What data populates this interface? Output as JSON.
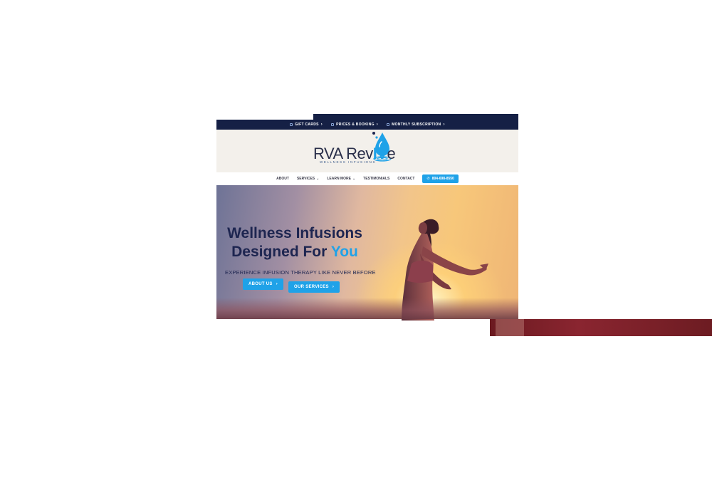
{
  "topbar": {
    "items": [
      {
        "label": "GIFT CARDS"
      },
      {
        "label": "PRICES & BOOKING"
      },
      {
        "label": "MONTHLY SUBSCRIPTION"
      }
    ]
  },
  "logo": {
    "brand_start": "RVA Rev",
    "brand_iv": "IV",
    "brand_end": "e",
    "tagline": "WELLNESS INFUSIONS"
  },
  "nav": {
    "items": [
      {
        "label": "ABOUT",
        "has_dropdown": false
      },
      {
        "label": "SERVICES",
        "has_dropdown": true
      },
      {
        "label": "LEARN MORE",
        "has_dropdown": true
      },
      {
        "label": "TESTIMONIALS",
        "has_dropdown": false
      },
      {
        "label": "CONTACT",
        "has_dropdown": false
      }
    ],
    "phone": "804-698-8550"
  },
  "hero": {
    "headline_line1": "Wellness Infusions",
    "headline_line2_start": "Designed For ",
    "headline_line2_accent": "You",
    "subline": "EXPERIENCE INFUSION THERAPY LIKE NEVER BEFORE",
    "buttons": {
      "about": "ABOUT US",
      "services": "OUR SERVICES"
    }
  },
  "colors": {
    "navy": "#152045",
    "accent_blue": "#1fa2e8",
    "header_bg": "#f3f0eb"
  },
  "icons": {
    "chevron": "chevron-right-icon",
    "phone": "phone-icon",
    "drop": "water-drop-icon"
  }
}
